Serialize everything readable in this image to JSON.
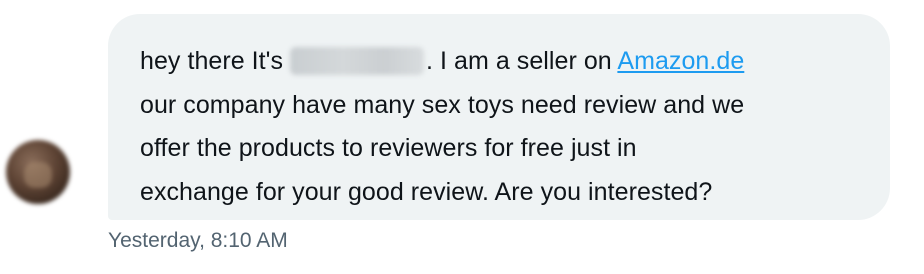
{
  "conversation": {
    "avatar_icon": "blurred-user-avatar-icon",
    "message": {
      "line1_prefix": "hey there It's",
      "line1_suffix": ". I am a seller on",
      "link_text": "Amazon.de",
      "line2": "our company have many sex toys need review and we",
      "line3": "offer the products to reviewers for free just in",
      "line4": "exchange for your good review. Are you interested?"
    },
    "timestamp": "Yesterday, 8:10 AM"
  },
  "colors": {
    "bubble_background": "#eff3f4",
    "link": "#1d9bf0",
    "timestamp": "#536471",
    "text": "#0f1419"
  }
}
